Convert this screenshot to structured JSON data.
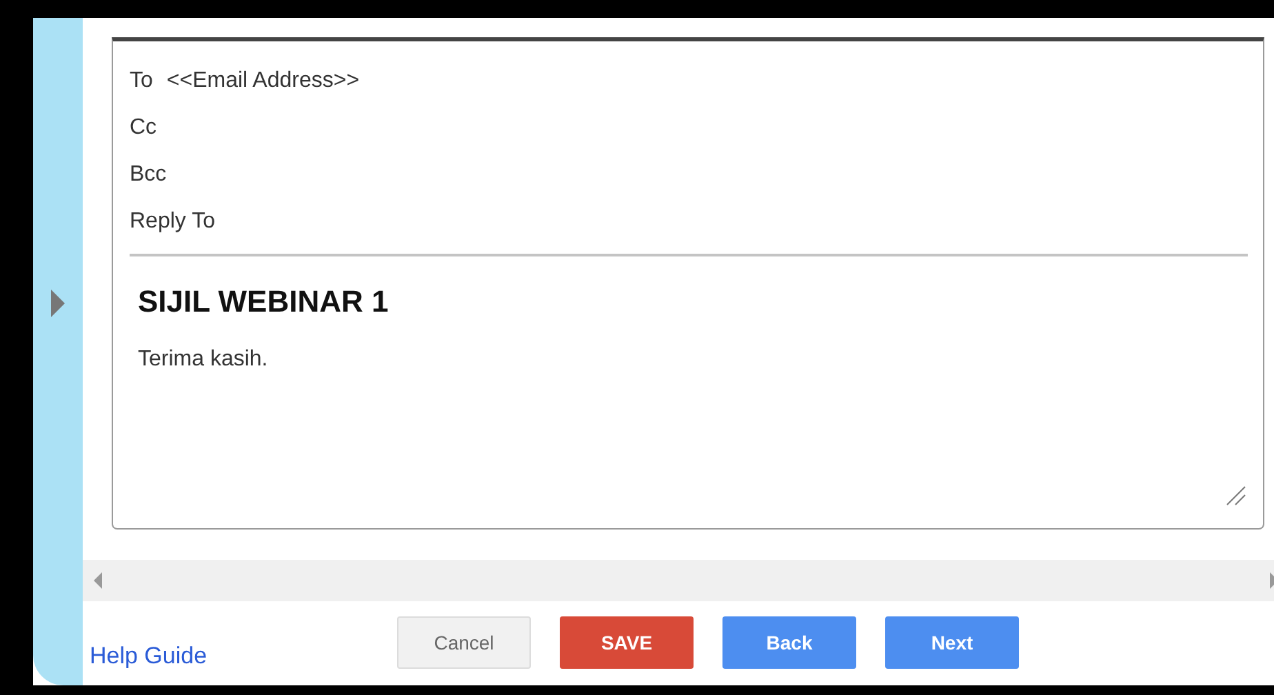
{
  "email": {
    "fields": [
      {
        "label": "To",
        "value": "<<Email Address>>"
      },
      {
        "label": "Cc"
      },
      {
        "label": "Bcc"
      },
      {
        "label": "Reply To"
      }
    ],
    "subject_heading": "SIJIL WEBINAR 1",
    "body": "Terima kasih."
  },
  "help_link": "Help Guide",
  "buttons": [
    {
      "label": "Cancel",
      "kind": "cancel"
    },
    {
      "label": "SAVE",
      "kind": "save"
    },
    {
      "label": "Back",
      "kind": "primary"
    },
    {
      "label": "Next",
      "kind": "primary"
    }
  ]
}
